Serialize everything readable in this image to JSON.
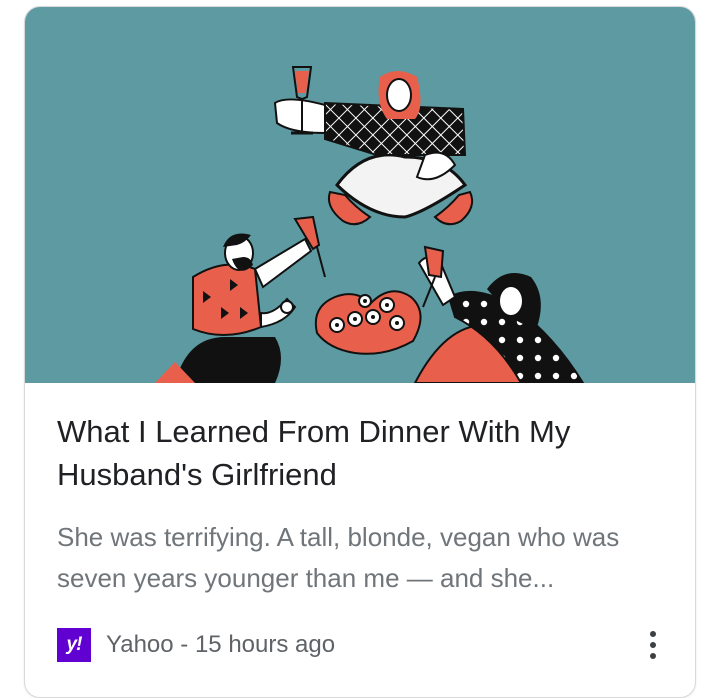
{
  "card": {
    "headline": "What I Learned From Dinner With My Husband's Girlfriend",
    "snippet": "She was terrifying. A tall, blonde, vegan who was seven years younger than me — and she...",
    "source": {
      "logo_text": "y!",
      "name": "Yahoo",
      "separator": " - ",
      "time": "15 hours ago"
    },
    "more_icon": "more-vert-icon",
    "hero_image": "illustration-dinner-three-people"
  },
  "colors": {
    "hero_background": "#5e9aa1",
    "accent_red": "#e8604c",
    "yahoo_purple": "#6001d2",
    "headline_text": "#202124",
    "snippet_text": "#70757a"
  }
}
